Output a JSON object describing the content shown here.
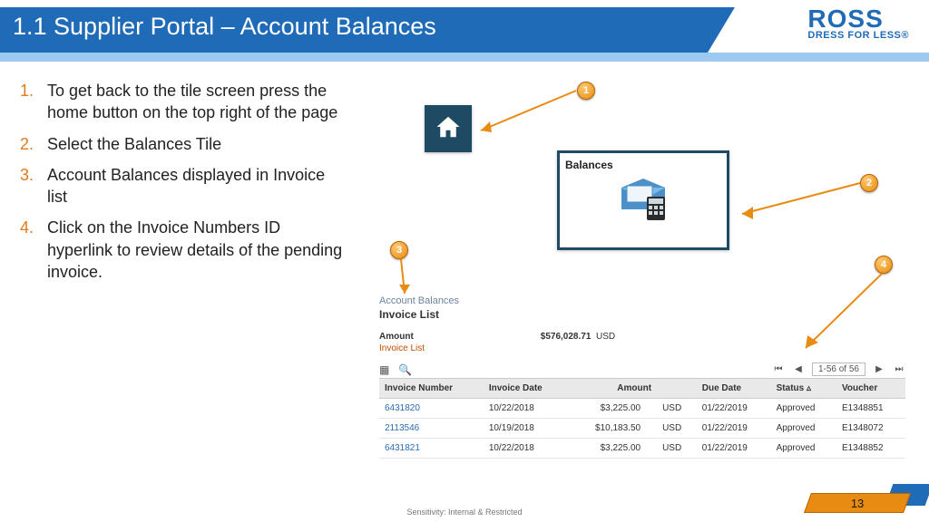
{
  "header": {
    "title": "1.1 Supplier Portal – Account Balances"
  },
  "logo": {
    "main": "ROSS",
    "sub": "DRESS FOR LESS®"
  },
  "steps": [
    "To get back to the tile screen press the home button on the top right of the page",
    "Select the Balances Tile",
    "Account Balances displayed in Invoice list",
    "Click on the Invoice Numbers ID hyperlink to review details of the pending invoice."
  ],
  "markers": {
    "m1": "1",
    "m2": "2",
    "m3": "3",
    "m4": "4"
  },
  "balances_tile": {
    "title": "Balances"
  },
  "invoice_panel": {
    "breadcrumb": "Account Balances",
    "heading": "Invoice List",
    "amount_label": "Amount",
    "amount_value": "$576,028.71",
    "amount_ccy": "USD",
    "sub": "Invoice List",
    "pager": {
      "range": "1-56 of 56"
    },
    "columns": [
      "Invoice Number",
      "Invoice Date",
      "Amount",
      "",
      "Due Date",
      "Status ▵",
      "Voucher"
    ],
    "rows": [
      {
        "num": "6431820",
        "date": "10/22/2018",
        "amt": "$3,225.00",
        "ccy": "USD",
        "due": "01/22/2019",
        "status": "Approved",
        "voucher": "E1348851"
      },
      {
        "num": "2113546",
        "date": "10/19/2018",
        "amt": "$10,183.50",
        "ccy": "USD",
        "due": "01/22/2019",
        "status": "Approved",
        "voucher": "E1348072"
      },
      {
        "num": "6431821",
        "date": "10/22/2018",
        "amt": "$3,225.00",
        "ccy": "USD",
        "due": "01/22/2019",
        "status": "Approved",
        "voucher": "E1348852"
      }
    ]
  },
  "footer": {
    "sensitivity": "Sensitivity: Internal & Restricted",
    "page": "13"
  }
}
